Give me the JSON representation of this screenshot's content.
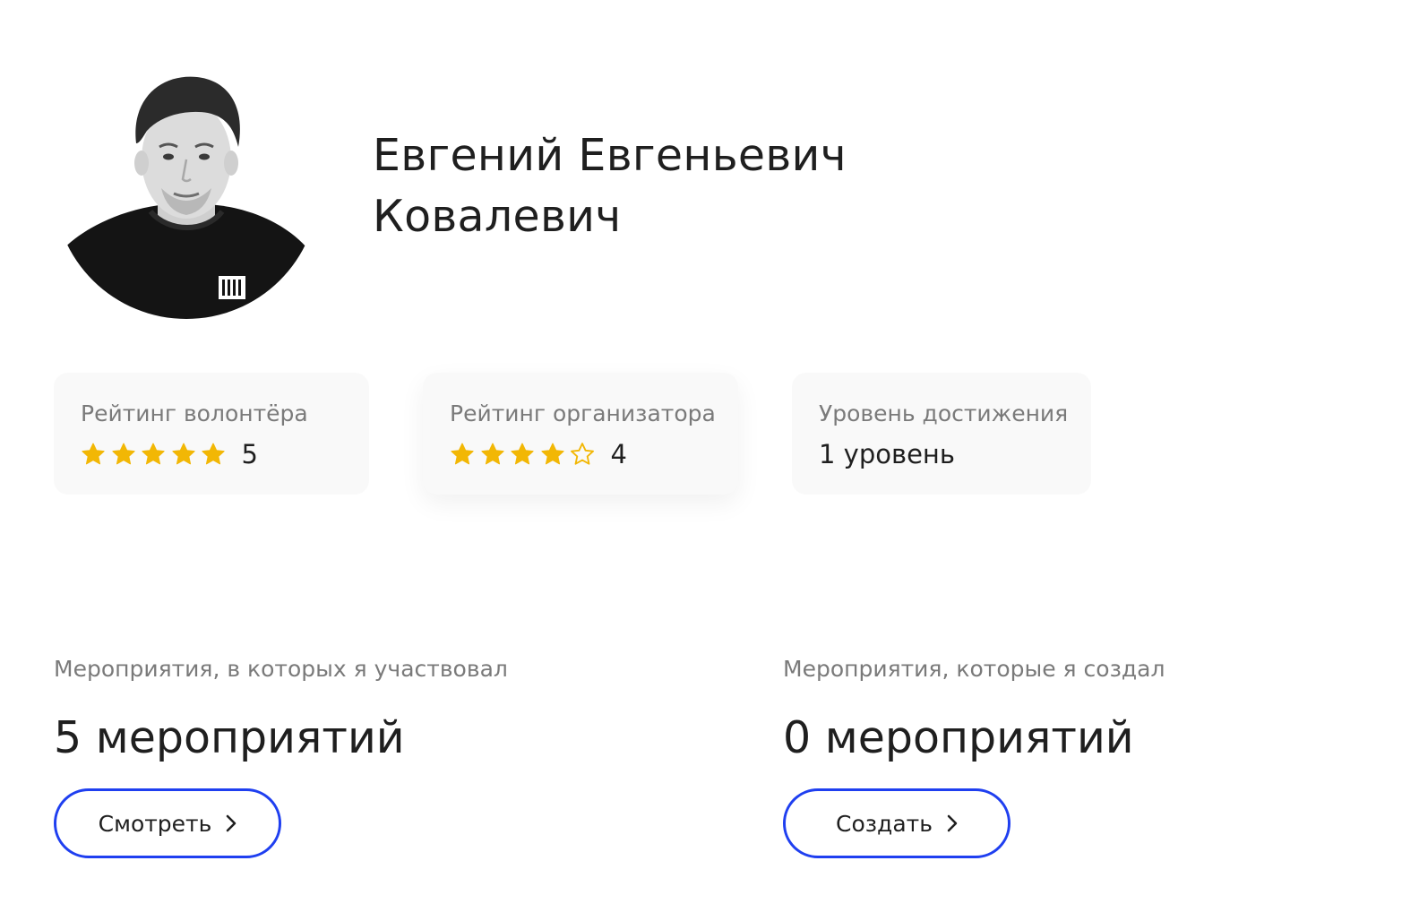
{
  "profile": {
    "name_line1": "Евгений Евгеньевич",
    "name_line2": "Ковалевич",
    "avatar_icon": "person-photo"
  },
  "colors": {
    "star": "#F2B705",
    "accent": "#1F3FF0",
    "card_bg": "#F9F9F9",
    "muted_text": "#7A7A7A"
  },
  "cards": {
    "volunteer": {
      "label": "Рейтинг волонтёра",
      "rating": "5",
      "stars_filled": 5,
      "stars_total": 5
    },
    "organizer": {
      "label": "Рейтинг организатора",
      "rating": "4",
      "stars_filled": 4,
      "stars_total": 5
    },
    "level": {
      "label": "Уровень достижения",
      "value": "1 уровень"
    }
  },
  "participated": {
    "label": "Мероприятия, в которых я участвовал",
    "count": "5 мероприятий",
    "button_label": "Смотреть",
    "button_icon": "chevron-right-icon"
  },
  "created": {
    "label": "Мероприятия, которые я создал",
    "count": "0 мероприятий",
    "button_label": "Создать",
    "button_icon": "chevron-right-icon"
  }
}
